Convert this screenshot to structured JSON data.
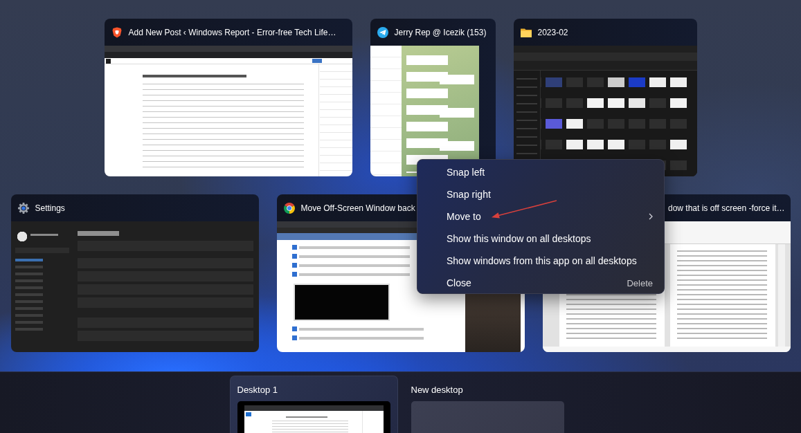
{
  "window_rows": [
    {
      "windows": [
        {
          "kind": "web-editor",
          "title": "Add New Post ‹ Windows Report - Error-free Tech Life…"
        },
        {
          "kind": "chat",
          "title": "Jerry Rep @ Icezik (153)"
        },
        {
          "kind": "file-explorer",
          "title": "2023-02"
        }
      ]
    },
    {
      "windows": [
        {
          "kind": "settings",
          "title": "Settings"
        },
        {
          "kind": "article",
          "title": "Move Off-Screen Window back"
        },
        {
          "kind": "document",
          "title": "dow that is off screen -force it…"
        }
      ]
    }
  ],
  "context_menu": {
    "items": [
      {
        "label": "Snap left",
        "submenu": false
      },
      {
        "label": "Snap right",
        "submenu": false
      },
      {
        "label": "Move to",
        "submenu": true
      },
      {
        "label": "Show this window on all desktops",
        "submenu": false
      },
      {
        "label": "Show windows from this app on all desktops",
        "submenu": false
      },
      {
        "label": "Close",
        "submenu": false,
        "shortcut": "Delete"
      }
    ]
  },
  "annotations": [
    {
      "kind": "arrow"
    }
  ],
  "desktops": [
    {
      "label": "Desktop 1",
      "selected": true,
      "kind": "desktop"
    },
    {
      "label": "New desktop",
      "selected": false,
      "kind": "new"
    }
  ]
}
